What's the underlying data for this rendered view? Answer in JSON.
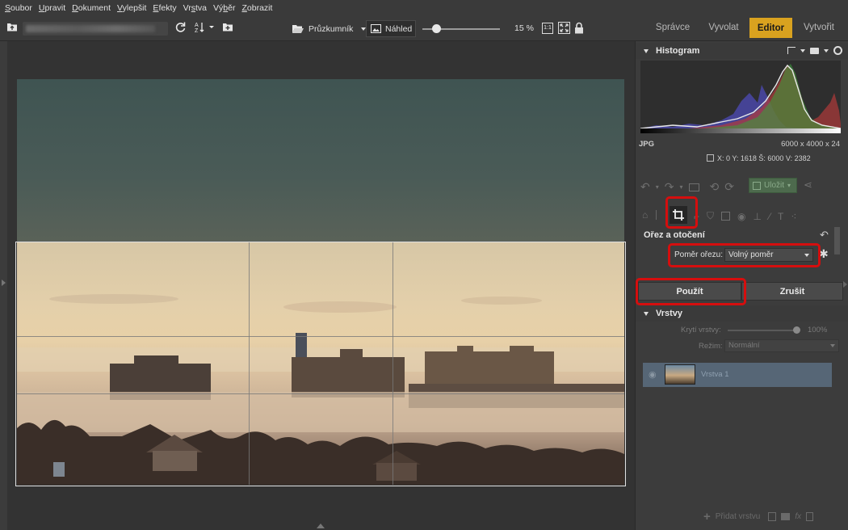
{
  "menu": [
    {
      "label": "Soubor",
      "u": "S"
    },
    {
      "label": "Upravit",
      "u": "U"
    },
    {
      "label": "Dokument",
      "u": "D"
    },
    {
      "label": "Vylepšit",
      "u": "V"
    },
    {
      "label": "Efekty",
      "u": "E"
    },
    {
      "label": "Vrstva",
      "u": "s"
    },
    {
      "label": "Výběr",
      "u": "b"
    },
    {
      "label": "Zobrazit",
      "u": "Z"
    }
  ],
  "toolbar": {
    "explorer_label": "Průzkumník",
    "preview_label": "Náhled",
    "zoom_value": "15 %",
    "zoom_fraction": 0.18,
    "ratio_label": "1:1"
  },
  "modes": {
    "manager": "Správce",
    "develop": "Vyvolat",
    "editor": "Editor",
    "create": "Vytvořit"
  },
  "histogram": {
    "title": "Histogram",
    "format": "JPG",
    "dimensions": "6000 x 4000 x 24",
    "coords": "X: 0 Y: 1618 Š: 6000 V: 2382"
  },
  "actions": {
    "save_label": "Uložit"
  },
  "crop": {
    "title": "Ořez a otočení",
    "ratio_label": "Poměr ořezu:",
    "ratio_value": "Volný poměr",
    "apply_label": "Použít",
    "cancel_label": "Zrušit"
  },
  "layers": {
    "title": "Vrstvy",
    "opacity_label": "Krytí vrstvy:",
    "opacity_value": "100%",
    "mode_label": "Režim:",
    "mode_value": "Normální",
    "layer_name": "Vrstva 1",
    "add_layer_label": "Přidat vrstvu"
  },
  "colors": {
    "accent": "#d9a21f",
    "highlight_ring": "#d50e0e",
    "panel_bg": "#3c3c3c",
    "canvas_bg": "#333333"
  }
}
